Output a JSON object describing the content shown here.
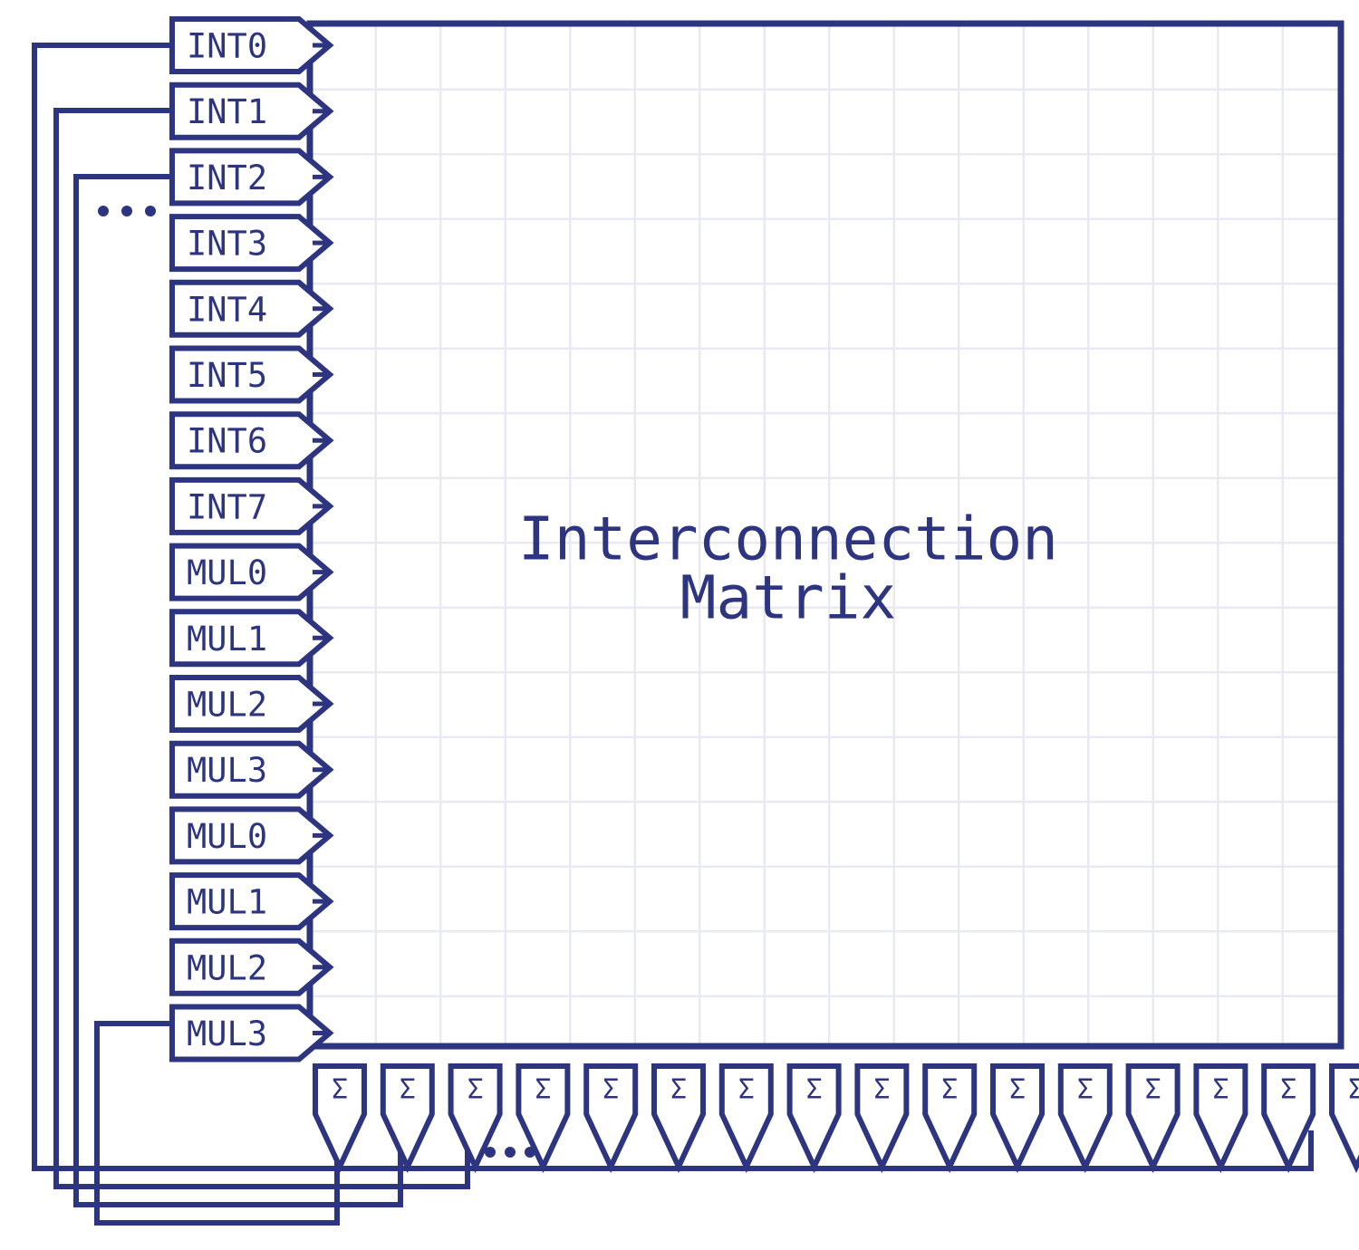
{
  "diagram": {
    "title_line1": "Interconnection",
    "title_line2": "Matrix",
    "stroke_color": "#2d3480",
    "grid_color": "#e8e9f3",
    "background": "#ffffff",
    "ellipsis_left": "...",
    "ellipsis_bottom": "...",
    "input_ports": [
      {
        "label": "INT0"
      },
      {
        "label": "INT1"
      },
      {
        "label": "INT2"
      },
      {
        "label": "INT3"
      },
      {
        "label": "INT4"
      },
      {
        "label": "INT5"
      },
      {
        "label": "INT6"
      },
      {
        "label": "INT7"
      },
      {
        "label": "MUL0"
      },
      {
        "label": "MUL1"
      },
      {
        "label": "MUL2"
      },
      {
        "label": "MUL3"
      },
      {
        "label": "MUL0"
      },
      {
        "label": "MUL1"
      },
      {
        "label": "MUL2"
      },
      {
        "label": "MUL3"
      }
    ],
    "output_ports": [
      {
        "label": "Σ"
      },
      {
        "label": "Σ"
      },
      {
        "label": "Σ"
      },
      {
        "label": "Σ"
      },
      {
        "label": "Σ"
      },
      {
        "label": "Σ"
      },
      {
        "label": "Σ"
      },
      {
        "label": "Σ"
      },
      {
        "label": "Σ"
      },
      {
        "label": "Σ"
      },
      {
        "label": "Σ"
      },
      {
        "label": "Σ"
      },
      {
        "label": "Σ"
      },
      {
        "label": "Σ"
      },
      {
        "label": "Σ"
      },
      {
        "label": "Σ"
      }
    ]
  }
}
